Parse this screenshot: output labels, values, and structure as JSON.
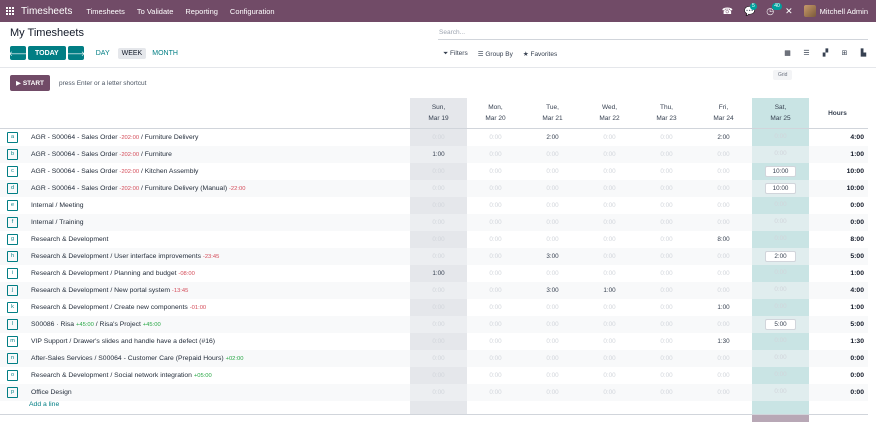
{
  "topbar": {
    "app_title": "Timesheets",
    "menu": [
      "Timesheets",
      "To Validate",
      "Reporting",
      "Configuration"
    ],
    "chat_badge": "5",
    "activity_badge": "40",
    "user_name": "Mitchell Admin"
  },
  "page": {
    "title": "My Timesheets",
    "search_placeholder": "Search...",
    "today_label": "TODAY",
    "ranges": [
      "DAY",
      "WEEK",
      "MONTH"
    ],
    "active_range": "WEEK",
    "filters": [
      "Filters",
      "Group By",
      "Favorites"
    ],
    "view_tooltip": "Grid",
    "start_label": "START",
    "hint": "press Enter or a letter shortcut",
    "add_line": "Add a line"
  },
  "columns": [
    {
      "day": "Sun,",
      "date": "Mar 19"
    },
    {
      "day": "Mon,",
      "date": "Mar 20"
    },
    {
      "day": "Tue,",
      "date": "Mar 21"
    },
    {
      "day": "Wed,",
      "date": "Mar 22"
    },
    {
      "day": "Thu,",
      "date": "Mar 23"
    },
    {
      "day": "Fri,",
      "date": "Mar 24"
    },
    {
      "day": "Sat,",
      "date": "Mar 25"
    }
  ],
  "total_header": "Hours",
  "rows": [
    {
      "key": "a",
      "project": "AGR - S00064 - Sales Order",
      "red": "-202:00",
      "green": "",
      "task": "Furniture Delivery",
      "task_red": "",
      "task_green": "",
      "values": [
        "0:00",
        "0:00",
        "2:00",
        "0:00",
        "0:00",
        "2:00",
        "0:00"
      ],
      "total": "4:00"
    },
    {
      "key": "b",
      "project": "AGR - S00064 - Sales Order",
      "red": "-202:00",
      "green": "",
      "task": "Furniture",
      "task_red": "",
      "task_green": "",
      "values": [
        "1:00",
        "0:00",
        "0:00",
        "0:00",
        "0:00",
        "0:00",
        "0:00"
      ],
      "total": "1:00"
    },
    {
      "key": "c",
      "project": "AGR - S00064 - Sales Order",
      "red": "-202:00",
      "green": "",
      "task": "Kitchen Assembly",
      "task_red": "",
      "task_green": "",
      "values": [
        "0:00",
        "0:00",
        "0:00",
        "0:00",
        "0:00",
        "0:00",
        "10:00"
      ],
      "total": "10:00"
    },
    {
      "key": "d",
      "project": "AGR - S00064 - Sales Order",
      "red": "-202:00",
      "green": "",
      "task": "Furniture Delivery (Manual)",
      "task_red": "-22:00",
      "task_green": "",
      "values": [
        "0:00",
        "0:00",
        "0:00",
        "0:00",
        "0:00",
        "0:00",
        "10:00"
      ],
      "total": "10:00"
    },
    {
      "key": "e",
      "project": "Internal",
      "red": "",
      "green": "",
      "task": "Meeting",
      "task_red": "",
      "task_green": "",
      "values": [
        "0:00",
        "0:00",
        "0:00",
        "0:00",
        "0:00",
        "0:00",
        "0:00"
      ],
      "total": "0:00"
    },
    {
      "key": "f",
      "project": "Internal",
      "red": "",
      "green": "",
      "task": "Training",
      "task_red": "",
      "task_green": "",
      "values": [
        "0:00",
        "0:00",
        "0:00",
        "0:00",
        "0:00",
        "0:00",
        "0:00"
      ],
      "total": "0:00"
    },
    {
      "key": "g",
      "project": "Research & Development",
      "red": "",
      "green": "",
      "task": "",
      "task_red": "",
      "task_green": "",
      "values": [
        "0:00",
        "0:00",
        "0:00",
        "0:00",
        "0:00",
        "8:00",
        "0:00"
      ],
      "total": "8:00"
    },
    {
      "key": "h",
      "project": "Research & Development",
      "red": "",
      "green": "",
      "task": "User interface improvements",
      "task_red": "-23:45",
      "task_green": "",
      "values": [
        "0:00",
        "0:00",
        "3:00",
        "0:00",
        "0:00",
        "0:00",
        "2:00"
      ],
      "total": "5:00"
    },
    {
      "key": "i",
      "project": "Research & Development",
      "red": "",
      "green": "",
      "task": "Planning and budget",
      "task_red": "-08:00",
      "task_green": "",
      "values": [
        "1:00",
        "0:00",
        "0:00",
        "0:00",
        "0:00",
        "0:00",
        "0:00"
      ],
      "total": "1:00"
    },
    {
      "key": "j",
      "project": "Research & Development",
      "red": "",
      "green": "",
      "task": "New portal system",
      "task_red": "-13:45",
      "task_green": "",
      "values": [
        "0:00",
        "0:00",
        "3:00",
        "1:00",
        "0:00",
        "0:00",
        "0:00"
      ],
      "total": "4:00"
    },
    {
      "key": "k",
      "project": "Research & Development",
      "red": "",
      "green": "",
      "task": "Create new components",
      "task_red": "-01:00",
      "task_green": "",
      "values": [
        "0:00",
        "0:00",
        "0:00",
        "0:00",
        "0:00",
        "1:00",
        "0:00"
      ],
      "total": "1:00"
    },
    {
      "key": "l",
      "project": "S00086 · Risa",
      "red": "",
      "green": "+45:00",
      "task": "Risa's Project",
      "task_red": "",
      "task_green": "+45:00",
      "values": [
        "0:00",
        "0:00",
        "0:00",
        "0:00",
        "0:00",
        "0:00",
        "5:00"
      ],
      "total": "5:00"
    },
    {
      "key": "m",
      "project": "VIP Support",
      "red": "",
      "green": "",
      "task": "Drawer's slides and handle have a defect (#16)",
      "task_red": "",
      "task_green": "",
      "values": [
        "0:00",
        "0:00",
        "0:00",
        "0:00",
        "0:00",
        "1:30",
        "0:00"
      ],
      "total": "1:30"
    },
    {
      "key": "n",
      "project": "After-Sales Services",
      "red": "",
      "green": "",
      "task": "S00064 - Customer Care (Prepaid Hours)",
      "task_red": "",
      "task_green": "+02:00",
      "values": [
        "0:00",
        "0:00",
        "0:00",
        "0:00",
        "0:00",
        "0:00",
        "0:00"
      ],
      "total": "0:00"
    },
    {
      "key": "o",
      "project": "Research & Development",
      "red": "",
      "green": "",
      "task": "Social network integration",
      "task_red": "",
      "task_green": "+05:00",
      "values": [
        "0:00",
        "0:00",
        "0:00",
        "0:00",
        "0:00",
        "0:00",
        "0:00"
      ],
      "total": "0:00"
    },
    {
      "key": "p",
      "project": "Office Design",
      "red": "",
      "green": "",
      "task": "",
      "task_red": "",
      "task_green": "",
      "values": [
        "0:00",
        "0:00",
        "0:00",
        "0:00",
        "0:00",
        "0:00",
        "0:00"
      ],
      "total": "0:00"
    }
  ]
}
